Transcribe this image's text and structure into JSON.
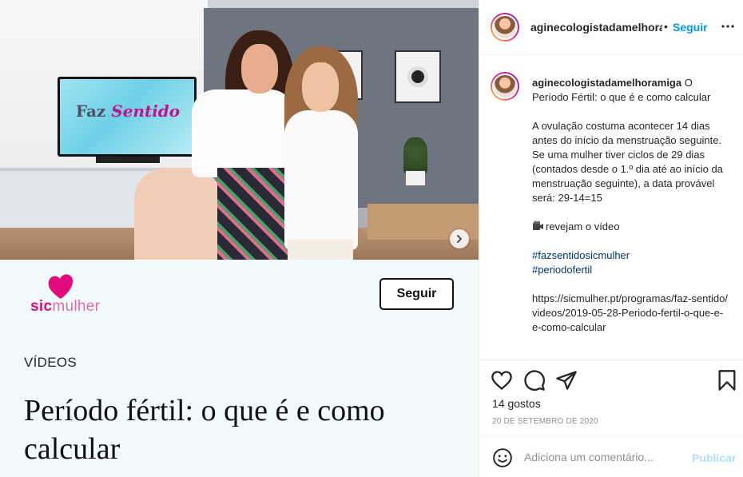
{
  "media": {
    "tv_logo_part1": "Faz ",
    "tv_logo_part2": "Sentido"
  },
  "card": {
    "brand_bold": "sic",
    "brand_light": "mulher",
    "follow_label": "Seguir",
    "category": "VÍDEOS",
    "title": "Período fértil: o que é e como calcular"
  },
  "post": {
    "username": "aginecologistadamelhoramiga",
    "separator": "•",
    "follow_label": "Seguir",
    "caption": {
      "username": "aginecologistadamelhoramiga",
      "headline": "O Período Fértil: o que é e como calcular",
      "paragraph": "A ovulação costuma acontecer 14 dias antes do início da menstruação seguinte. Se uma mulher tiver ciclos de 29 dias (contados desde o 1.º dia até ao início da menstruação seguinte), a data provável será: 29-14=15",
      "video_note": "revejam o vídeo",
      "hashtags": [
        "#fazsentidosicmulher",
        "#periodofertil"
      ],
      "link": "https://sicmulher.pt/programas/faz-sentido/videos/2019-05-28-Periodo-fertil-o-que-e-e-como-calcular"
    },
    "likes": "14 gostos",
    "date": "20 DE SETEMBRO DE 2020",
    "comment_placeholder": "Adiciona um comentário...",
    "post_label": "Publicar"
  },
  "icons": {
    "heart": "heart-icon",
    "comment": "comment-icon",
    "share": "share-icon",
    "save": "bookmark-icon",
    "more": "more-icon",
    "emoji": "emoji-icon",
    "next": "chevron-right-icon"
  },
  "colors": {
    "link_blue": "#0095f6",
    "hashtag": "#00376b",
    "brand_pink": "#e20a7d",
    "muted": "#8e8e8e",
    "post_disabled": "#b2dffc"
  }
}
